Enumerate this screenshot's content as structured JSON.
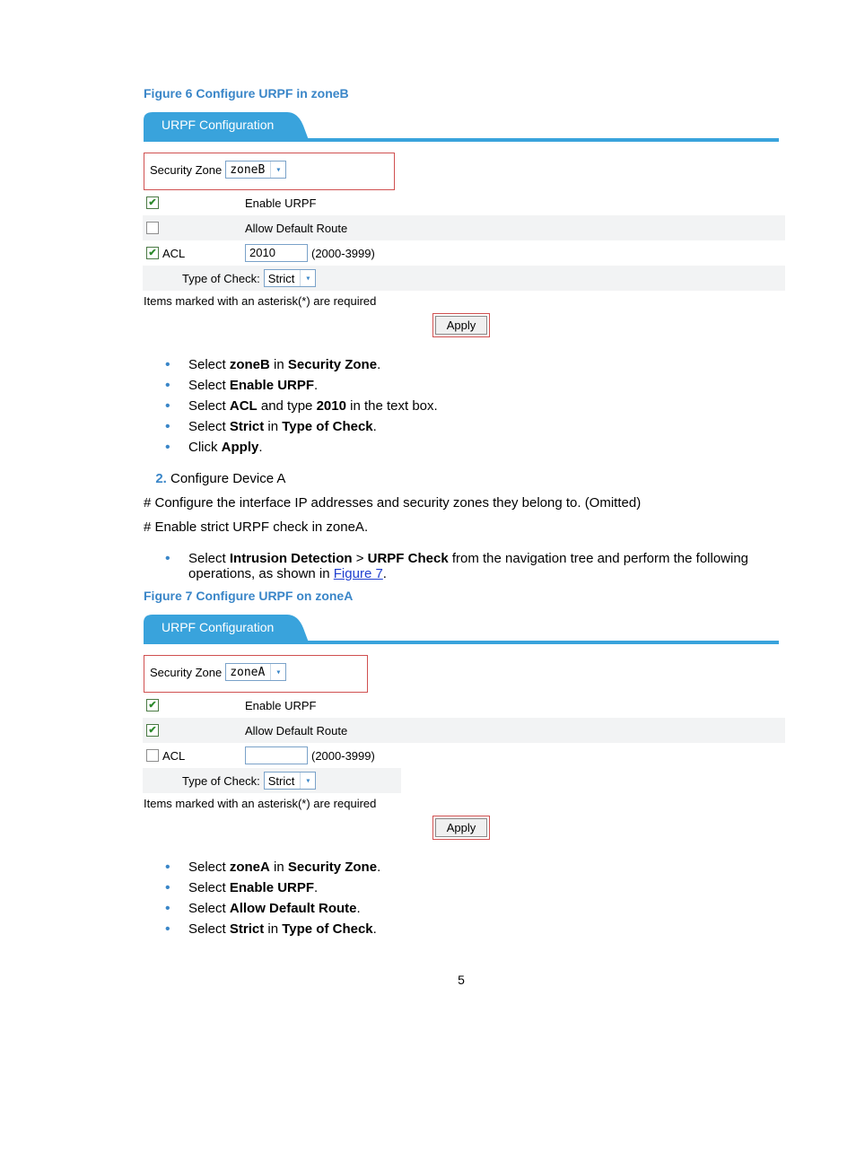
{
  "fig6": {
    "title": "Figure 6 Configure URPF in zoneB",
    "tab": "URPF Configuration",
    "securityZoneLabel": "Security Zone",
    "securityZoneValue": "zoneB",
    "enableUrpfLabel": "Enable URPF",
    "enableUrpfChecked": true,
    "allowDefaultLabel": "Allow Default Route",
    "allowDefaultChecked": false,
    "aclLabel": "ACL",
    "aclChecked": true,
    "aclValue": "2010",
    "aclRange": "(2000-3999)",
    "typeLabel": "Type of Check:",
    "typeValue": "Strict",
    "hint": "Items marked with an asterisk(*) are required",
    "apply": "Apply"
  },
  "bulletsA": {
    "i1a": "Select ",
    "i1b": "zoneB",
    "i1c": " in ",
    "i1d": "Security Zone",
    "i1e": ".",
    "i2a": "Select ",
    "i2b": "Enable URPF",
    "i2c": ".",
    "i3a": "Select ",
    "i3b": "ACL",
    "i3c": " and type ",
    "i3d": "2010",
    "i3e": " in the text box.",
    "i4a": "Select ",
    "i4b": "Strict",
    "i4c": " in ",
    "i4d": "Type of Check",
    "i4e": ".",
    "i5a": "Click ",
    "i5b": "Apply",
    "i5c": "."
  },
  "step2": "Configure Device A",
  "para1": "# Configure the interface IP addresses and security zones they belong to. (Omitted)",
  "para2": "# Enable strict URPF check in zoneA.",
  "navBullet": {
    "a": "Select ",
    "b": "Intrusion Detection",
    "c": " > ",
    "d": "URPF Check",
    "e": " from the navigation tree and perform the following operations, as shown in ",
    "link": "Figure 7",
    "f": "."
  },
  "fig7": {
    "title": "Figure 7 Configure URPF on zoneA",
    "tab": "URPF Configuration",
    "securityZoneLabel": "Security Zone",
    "securityZoneValue": "zoneA",
    "enableUrpfLabel": "Enable URPF",
    "enableUrpfChecked": true,
    "allowDefaultLabel": "Allow Default Route",
    "allowDefaultChecked": true,
    "aclLabel": "ACL",
    "aclChecked": false,
    "aclValue": "",
    "aclRange": "(2000-3999)",
    "typeLabel": "Type of Check:",
    "typeValue": "Strict",
    "hint": "Items marked with an asterisk(*) are required",
    "apply": "Apply"
  },
  "bulletsB": {
    "i1a": "Select ",
    "i1b": "zoneA",
    "i1c": " in ",
    "i1d": "Security Zone",
    "i1e": ".",
    "i2a": "Select ",
    "i2b": "Enable URPF",
    "i2c": ".",
    "i3a": "Select ",
    "i3b": "Allow Default Route",
    "i3c": ".",
    "i4a": "Select ",
    "i4b": "Strict",
    "i4c": " in ",
    "i4d": "Type of Check",
    "i4e": "."
  },
  "pageNumber": "5"
}
